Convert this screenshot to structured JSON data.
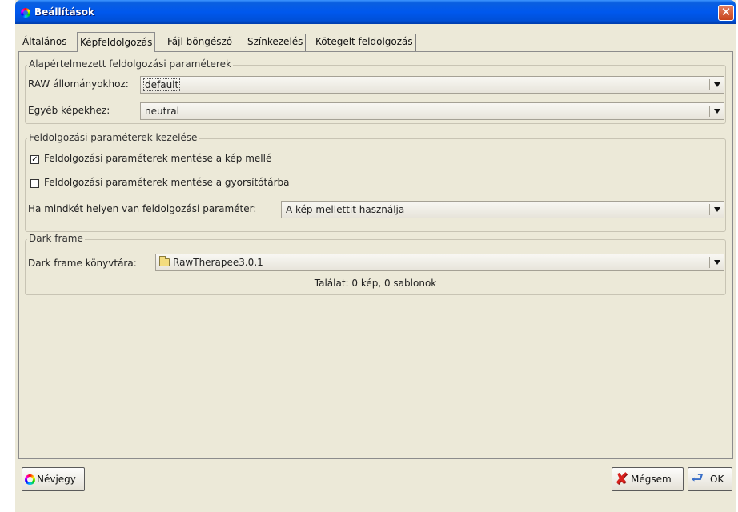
{
  "window": {
    "title": "Beállítások",
    "close_glyph": "✕"
  },
  "tabs": [
    {
      "label": "Általános",
      "active": false
    },
    {
      "label": "Képfeldolgozás",
      "active": true
    },
    {
      "label": "Fájl böngésző",
      "active": false
    },
    {
      "label": "Színkezelés",
      "active": false
    },
    {
      "label": "Kötegelt feldolgozás",
      "active": false
    }
  ],
  "default_params": {
    "legend": "Alapértelmezett feldolgozási paraméterek",
    "raw_label": "RAW állományokhoz:",
    "raw_value": "default",
    "other_label": "Egyéb képekhez:",
    "other_value": "neutral"
  },
  "param_handling": {
    "legend": "Feldolgozási paraméterek kezelése",
    "save_beside_label": "Feldolgozási paraméterek mentése a kép mellé",
    "save_beside_checked": true,
    "save_cache_label": "Feldolgozási paraméterek mentése a gyorsítótárba",
    "save_cache_checked": false,
    "both_label": "Ha mindkét helyen van feldolgozási paraméter:",
    "both_value": "A kép mellettit használja"
  },
  "dark_frame": {
    "legend": "Dark frame",
    "dir_label": "Dark frame könyvtára:",
    "dir_value": "RawTherapee3.0.1",
    "result": "Találat: 0 kép, 0 sablonok"
  },
  "buttons": {
    "about": "Névjegy",
    "cancel": "Mégsem",
    "ok": "OK"
  },
  "icons": {
    "app": "rawtherapee-logo-icon",
    "close": "close-icon",
    "combo": "dropdown-arrow-icon",
    "folder": "folder-icon",
    "check": "checkmark-icon",
    "cancel": "red-x-icon",
    "ok": "ok-return-arrow-icon"
  }
}
